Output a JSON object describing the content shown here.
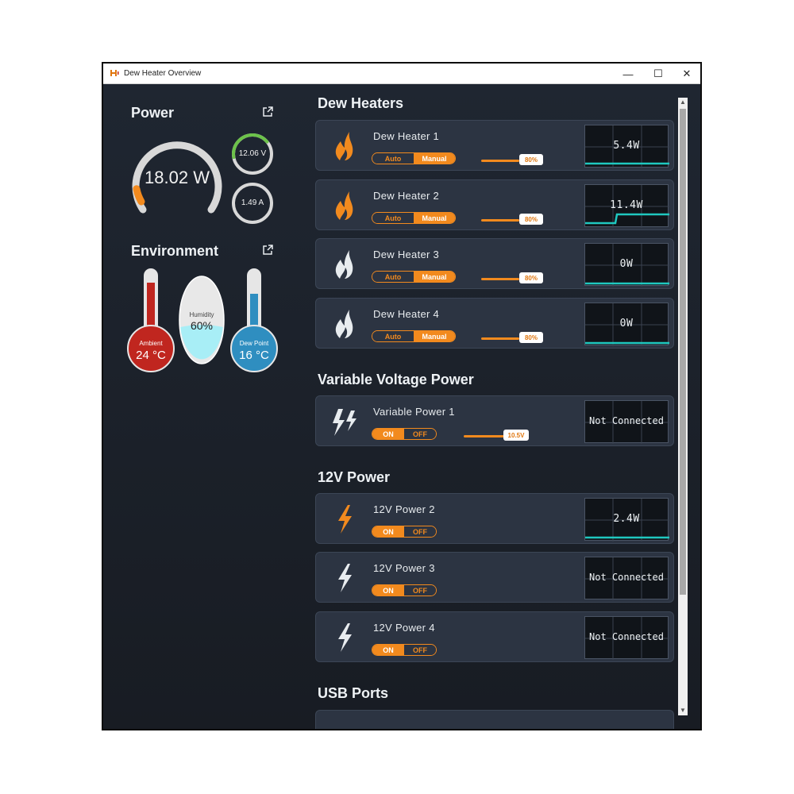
{
  "window": {
    "title": "Dew Heater Overview",
    "minimize": "—",
    "maximize": "☐",
    "close": "✕"
  },
  "power": {
    "heading": "Power",
    "watts": "18.02 W",
    "volts": "12.06 V",
    "amps": "1.49 A",
    "watt_level": 0.08,
    "volt_level": 0.75,
    "amp_level": 0.12
  },
  "environment": {
    "heading": "Environment",
    "ambient": {
      "label": "Ambient",
      "value": "24 °C"
    },
    "humidity": {
      "label": "Humidity",
      "value": "60%"
    },
    "dew_point": {
      "label": "Dew Point",
      "value": "16 °C"
    }
  },
  "dew_heaters": {
    "heading": "Dew Heaters",
    "items": [
      {
        "name": "Dew Heater 1",
        "auto": "Auto",
        "manual": "Manual",
        "slider": "80%",
        "level": 0.8,
        "monitor": "5.4W",
        "active": true
      },
      {
        "name": "Dew Heater 2",
        "auto": "Auto",
        "manual": "Manual",
        "slider": "80%",
        "level": 0.8,
        "monitor": "11.4W",
        "active": true
      },
      {
        "name": "Dew Heater 3",
        "auto": "Auto",
        "manual": "Manual",
        "slider": "80%",
        "level": 0.8,
        "monitor": "0W",
        "active": false
      },
      {
        "name": "Dew Heater 4",
        "auto": "Auto",
        "manual": "Manual",
        "slider": "80%",
        "level": 0.8,
        "monitor": "0W",
        "active": false
      }
    ]
  },
  "variable_power": {
    "heading": "Variable Voltage Power",
    "items": [
      {
        "name": "Variable Power 1",
        "on": "ON",
        "off": "OFF",
        "slider": "10.5V",
        "monitor": "Not Connected"
      }
    ]
  },
  "twelve_v": {
    "heading": "12V Power",
    "items": [
      {
        "name": "12V Power 2",
        "on": "ON",
        "off": "OFF",
        "monitor": "2.4W",
        "active": true
      },
      {
        "name": "12V Power 3",
        "on": "ON",
        "off": "OFF",
        "monitor": "Not Connected",
        "active": false
      },
      {
        "name": "12V Power 4",
        "on": "ON",
        "off": "OFF",
        "monitor": "Not Connected",
        "active": false
      }
    ]
  },
  "usb": {
    "heading": "USB Ports"
  },
  "colors": {
    "accent": "#f28a1e",
    "ambient": "#c0261f",
    "humidity": "#a8eef6",
    "dew_point": "#2f8ec0",
    "graph": "#1fc8c0"
  },
  "icons": {
    "heater_active": "flame-icon",
    "heater_inactive": "steam-icon",
    "variable": "double-bolt-icon",
    "power": "bolt-icon",
    "external": "external-link-icon"
  }
}
